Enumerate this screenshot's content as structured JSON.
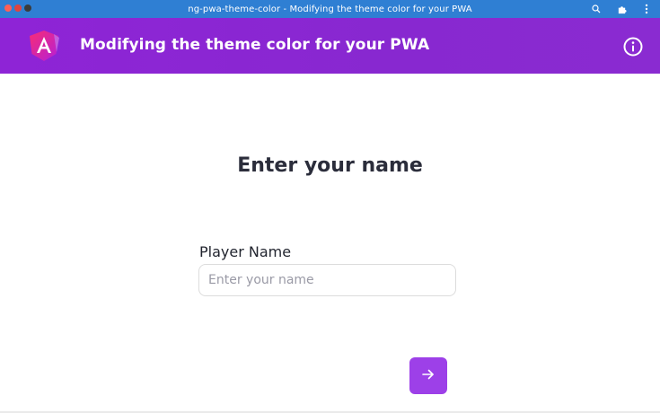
{
  "window": {
    "title": "ng-pwa-theme-color - Modifying the theme color for your PWA"
  },
  "appbar": {
    "title": "Modifying the theme color for your PWA",
    "logo_icon": "angular-logo-icon",
    "info_icon": "info-icon"
  },
  "main": {
    "heading": "Enter your name",
    "field_label": "Player Name",
    "input_value": "",
    "input_placeholder": "Enter your name",
    "next_icon": "arrow-right-icon"
  },
  "colors": {
    "titlebar": "#2f7fd3",
    "appbar": "#8e24d6",
    "button": "#9d40e8",
    "heading_text": "#2b2d3b"
  }
}
